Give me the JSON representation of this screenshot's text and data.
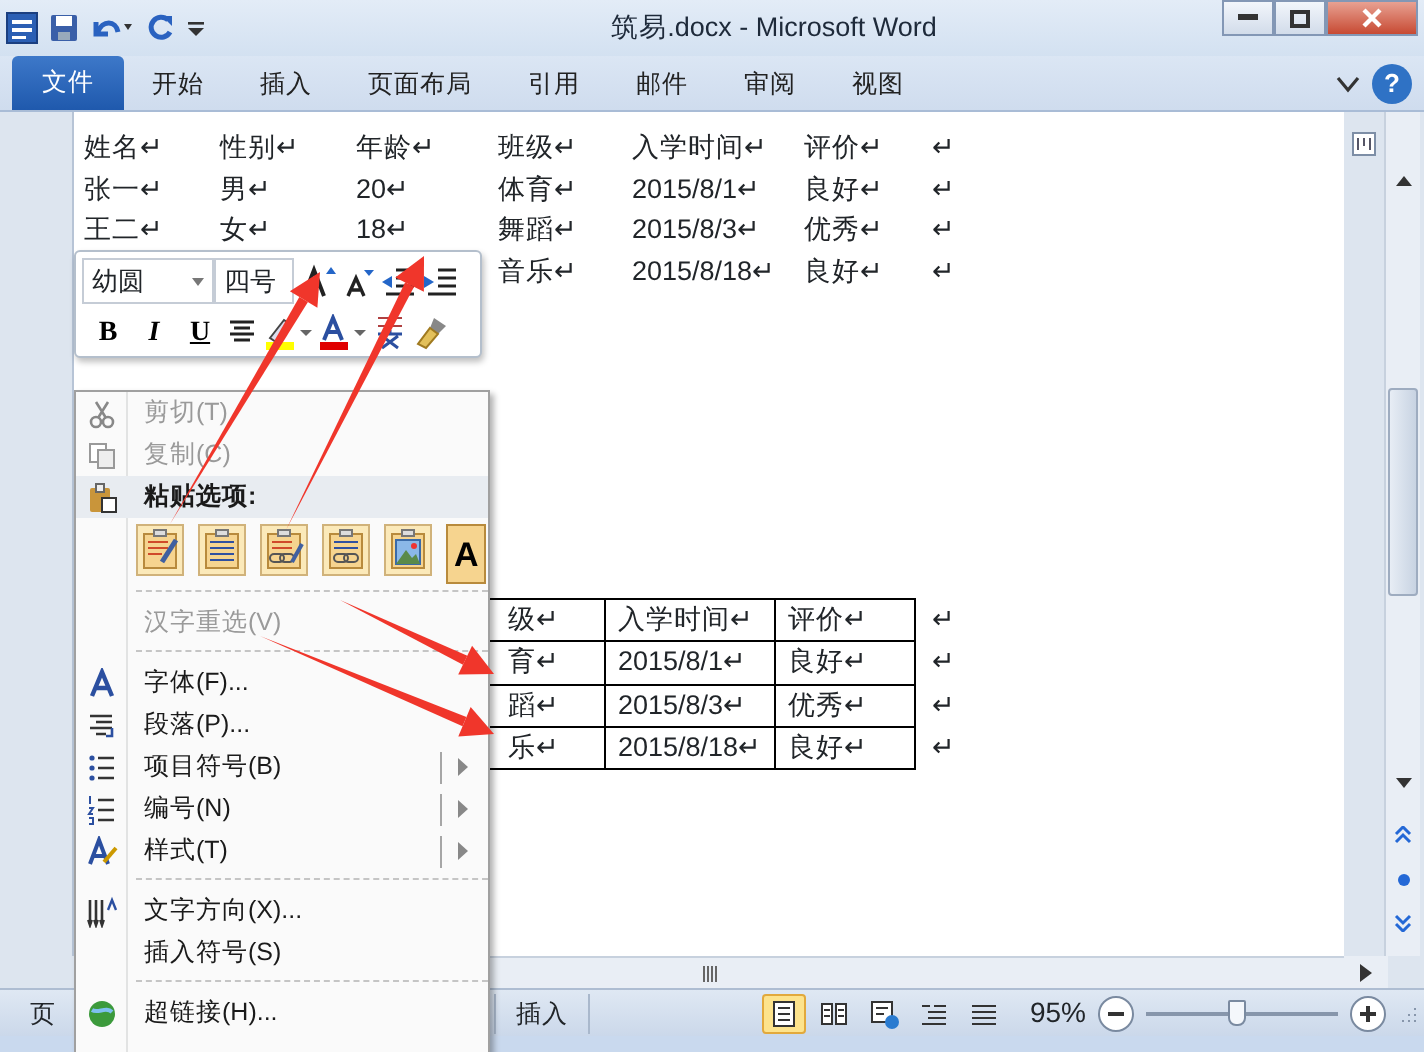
{
  "window": {
    "title": "筑易.docx - Microsoft Word"
  },
  "ribbon_tabs": [
    {
      "label": "文件",
      "kind": "file"
    },
    {
      "label": "开始",
      "kind": "tab"
    },
    {
      "label": "插入",
      "kind": "tab"
    },
    {
      "label": "页面布局",
      "kind": "tab"
    },
    {
      "label": "引用",
      "kind": "tab"
    },
    {
      "label": "邮件",
      "kind": "tab"
    },
    {
      "label": "审阅",
      "kind": "tab"
    },
    {
      "label": "视图",
      "kind": "tab"
    }
  ],
  "help": "?",
  "document": {
    "lines": [
      [
        "姓名↵",
        "性别↵",
        "年龄↵",
        "班级↵",
        "入学时间↵",
        "评价↵",
        "↵"
      ],
      [
        "张一↵",
        "男↵",
        "20↵",
        "体育↵",
        "2015/8/1↵",
        "良好↵",
        "↵"
      ],
      [
        "王二↵",
        "女↵",
        "18↵",
        "舞蹈↵",
        "2015/8/3↵",
        "优秀↵",
        "↵"
      ],
      [
        "音乐↵",
        "2015/8/18↵",
        "良好↵",
        "↵"
      ]
    ],
    "table": {
      "rows": [
        [
          "级↵",
          "入学时间↵",
          "评价↵",
          "↵"
        ],
        [
          "育↵",
          "2015/8/1↵",
          "良好↵",
          "↵"
        ],
        [
          "蹈↵",
          "2015/8/3↵",
          "优秀↵",
          "↵"
        ],
        [
          "乐↵",
          "2015/8/18↵",
          "良好↵",
          "↵"
        ]
      ]
    }
  },
  "mini_toolbar": {
    "font": "幼圆",
    "size": "四号",
    "bold": "B",
    "italic": "I",
    "underline": "U"
  },
  "context_menu": {
    "items": [
      {
        "kind": "item",
        "label": "剪切(T)",
        "disabled": true,
        "submenu": false
      },
      {
        "kind": "item",
        "label": "复制(C)",
        "disabled": true,
        "submenu": false
      },
      {
        "kind": "header",
        "label": "粘贴选项:"
      },
      {
        "kind": "paste",
        "options": [
          {
            "kind": "formatting"
          },
          {
            "kind": "merge"
          },
          {
            "kind": "formatting_link"
          },
          {
            "kind": "link"
          },
          {
            "kind": "picture"
          },
          {
            "kind": "text",
            "label": "A"
          }
        ]
      },
      {
        "kind": "separator"
      },
      {
        "kind": "item",
        "label": "汉字重选(V)",
        "disabled": true,
        "submenu": false
      },
      {
        "kind": "separator"
      },
      {
        "kind": "item",
        "label": "字体(F)...",
        "disabled": false,
        "submenu": false
      },
      {
        "kind": "item",
        "label": "段落(P)...",
        "disabled": false,
        "submenu": false
      },
      {
        "kind": "item",
        "label": "项目符号(B)",
        "disabled": false,
        "submenu": true
      },
      {
        "kind": "item",
        "label": "编号(N)",
        "disabled": false,
        "submenu": true
      },
      {
        "kind": "item",
        "label": "样式(T)",
        "disabled": false,
        "submenu": true
      },
      {
        "kind": "separator"
      },
      {
        "kind": "item",
        "label": "文字方向(X)...",
        "disabled": false,
        "submenu": false
      },
      {
        "kind": "item",
        "label": "插入符号(S)",
        "disabled": false,
        "submenu": false
      },
      {
        "kind": "separator"
      },
      {
        "kind": "item",
        "label": "超链接(H)...",
        "disabled": false,
        "submenu": false
      }
    ]
  },
  "status_bar": {
    "page": "页",
    "mode": "插入",
    "views": [
      {
        "kind": "print",
        "selected": true
      },
      {
        "kind": "reading",
        "selected": false
      },
      {
        "kind": "web",
        "selected": false
      },
      {
        "kind": "outline",
        "selected": false
      },
      {
        "kind": "draft",
        "selected": false
      }
    ],
    "zoom": "95%",
    "level": 0.47
  }
}
